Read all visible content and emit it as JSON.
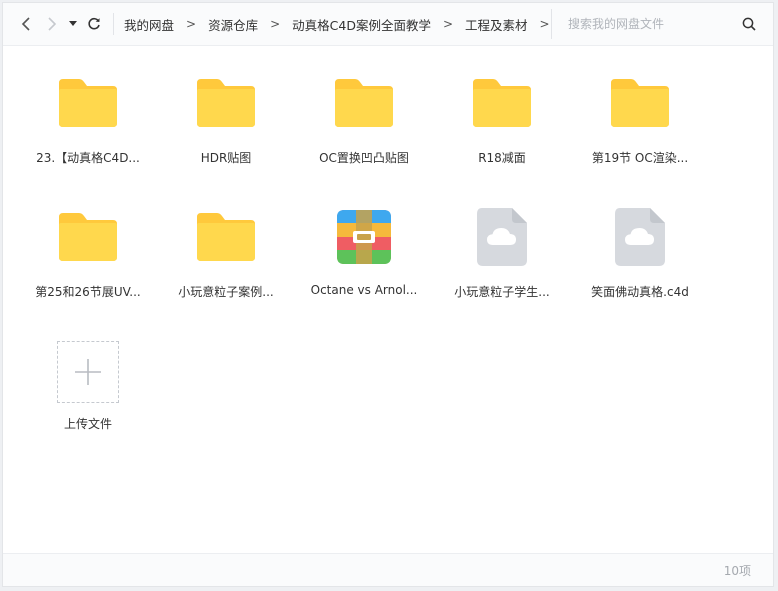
{
  "toolbar": {
    "back_icon": "chevron-left-icon",
    "forward_icon": "chevron-right-icon",
    "history_icon": "caret-down-icon",
    "refresh_icon": "refresh-icon"
  },
  "breadcrumb": {
    "items": [
      "我的网盘",
      "资源仓库",
      "动真格C4D案例全面教学",
      "工程及素材"
    ],
    "separator": ">"
  },
  "search": {
    "placeholder": "搜索我的网盘文件",
    "icon": "search-icon"
  },
  "files": [
    {
      "name": "23.【动真格C4D...",
      "type": "folder"
    },
    {
      "name": "HDR贴图",
      "type": "folder"
    },
    {
      "name": "OC置换凹凸贴图",
      "type": "folder"
    },
    {
      "name": "R18减面",
      "type": "folder"
    },
    {
      "name": "第19节 OC渲染...",
      "type": "folder"
    },
    {
      "name": "第25和26节展UV...",
      "type": "folder"
    },
    {
      "name": "小玩意粒子案例...",
      "type": "folder"
    },
    {
      "name": "Octane vs Arnol...",
      "type": "archive"
    },
    {
      "name": "小玩意粒子学生...",
      "type": "cloud-file"
    },
    {
      "name": "笑面佛动真格.c4d",
      "type": "cloud-file"
    }
  ],
  "upload": {
    "label": "上传文件",
    "icon": "plus-icon"
  },
  "footer": {
    "count": "10项"
  },
  "colors": {
    "folder": "#ffd84d",
    "folder_tab": "#ffc93c",
    "cloud_file": "#d6d9de",
    "accent": "#06a7ff"
  }
}
